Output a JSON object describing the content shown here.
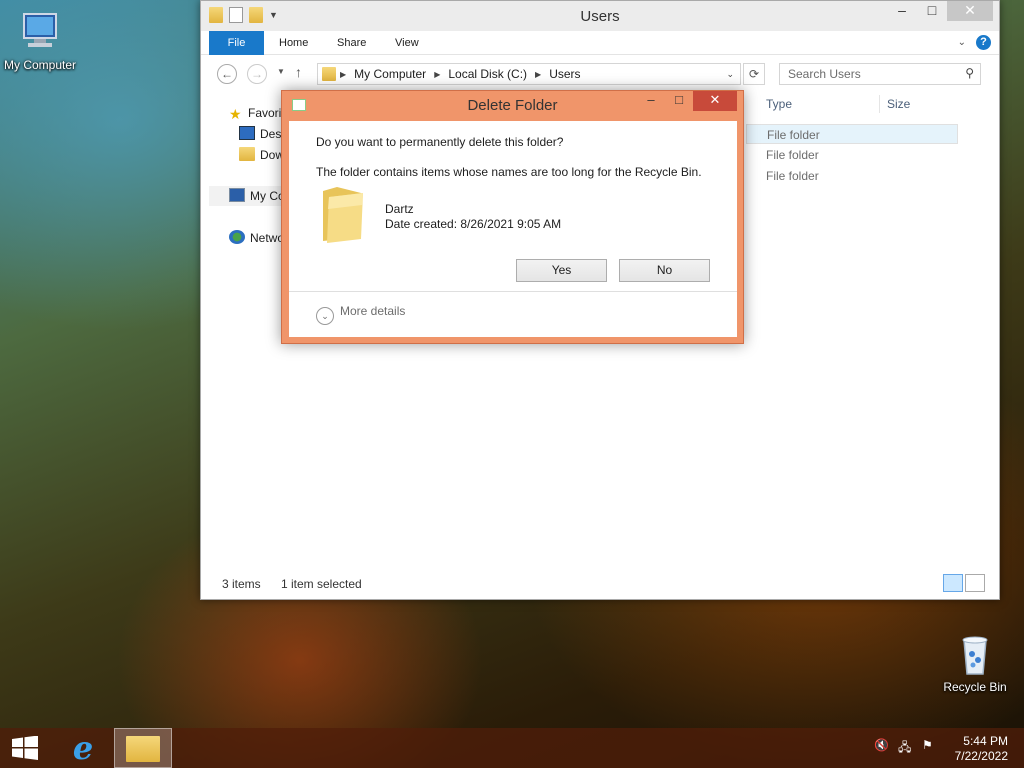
{
  "desktop": {
    "icons": [
      {
        "label": "My Computer",
        "icon": "computer-icon"
      },
      {
        "label": "Recycle Bin",
        "icon": "recycle-bin-icon"
      }
    ]
  },
  "explorer": {
    "title": "Users",
    "ribbon_tabs": [
      "File",
      "Home",
      "Share",
      "View"
    ],
    "address": [
      "My Computer",
      "Local Disk (C:)",
      "Users"
    ],
    "search_placeholder": "Search Users",
    "nav_items": [
      {
        "label": "Favorites",
        "icon": "star-icon"
      },
      {
        "label": "Desktop",
        "icon": "desktop-icon"
      },
      {
        "label": "Downloads",
        "icon": "downloads-icon"
      },
      {
        "label": "My Computer",
        "icon": "computer-icon"
      },
      {
        "label": "Network",
        "icon": "network-icon"
      }
    ],
    "columns": [
      "Type",
      "Size"
    ],
    "rows": [
      {
        "type": "File folder"
      },
      {
        "type": "File folder"
      },
      {
        "type": "File folder"
      }
    ],
    "status": {
      "count": "3 items",
      "selected": "1 item selected"
    }
  },
  "dialog": {
    "title": "Delete Folder",
    "question": "Do you want to permanently delete this folder?",
    "info": "The folder contains items whose names are too long for the Recycle Bin.",
    "folder_name": "Dartz",
    "date_created": "Date created: 8/26/2021 9:05 AM",
    "yes_label": "Yes",
    "no_label": "No",
    "more_details": "More details"
  },
  "taskbar": {
    "time": "5:44 PM",
    "date": "7/22/2022"
  }
}
